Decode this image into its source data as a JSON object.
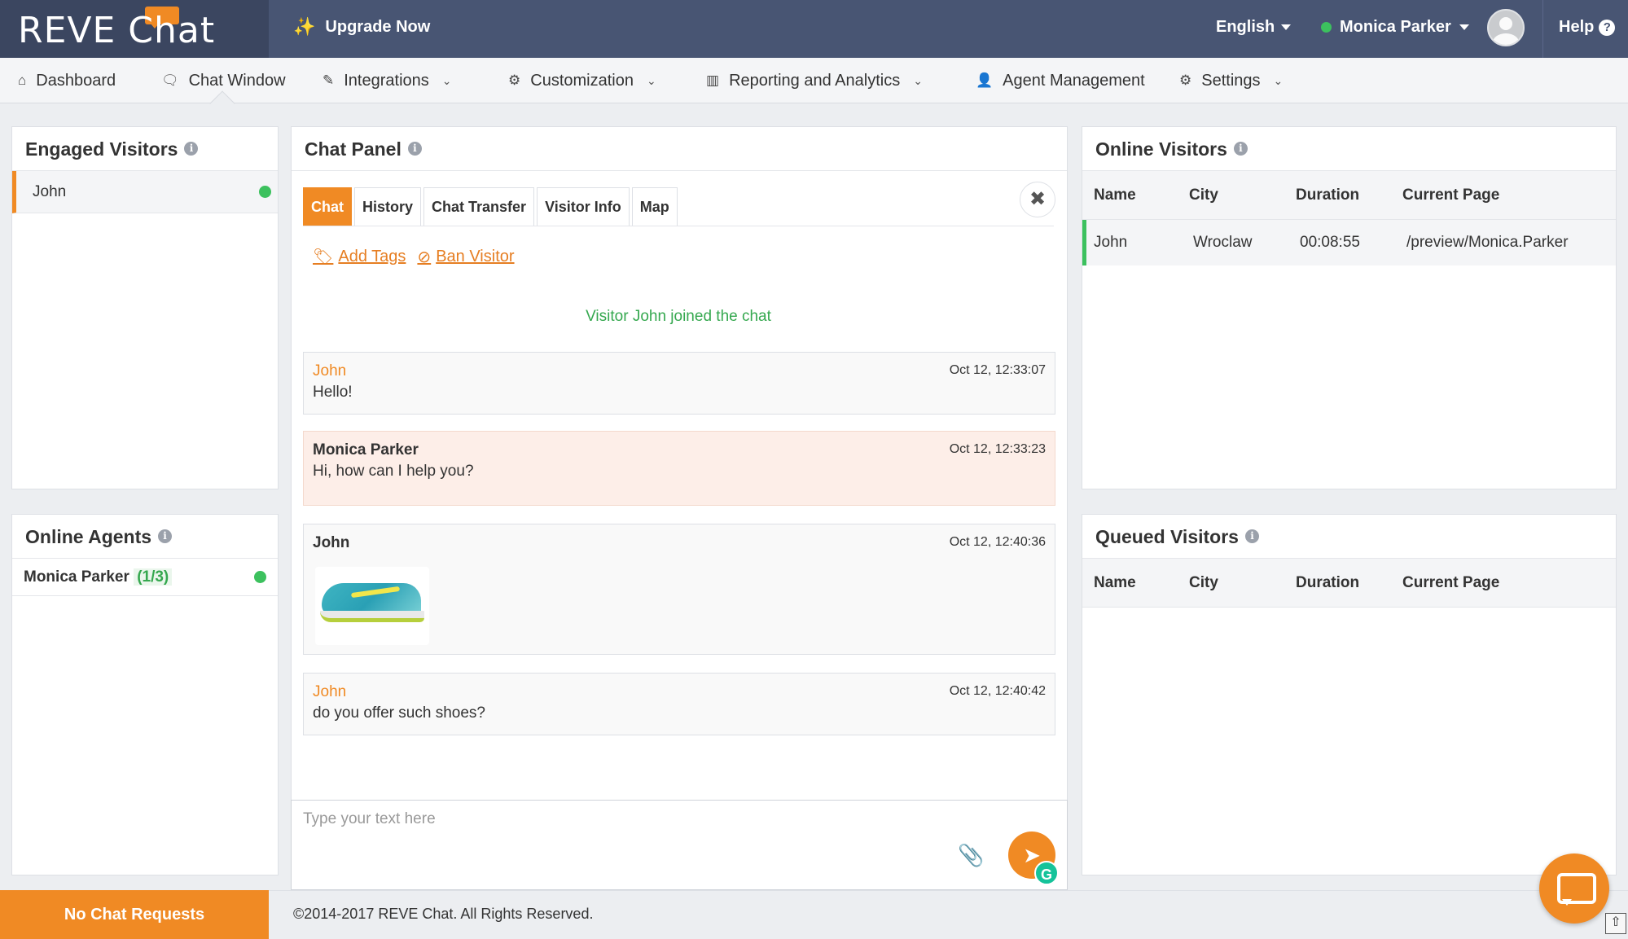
{
  "topbar": {
    "logo": "REVE Chat",
    "upgrade_label": "Upgrade Now",
    "language": "English",
    "agent_name": "Monica Parker",
    "help_label": "Help",
    "accent_color": "#f08a24",
    "bg_color": "#485573"
  },
  "nav": {
    "items": [
      {
        "label": "Dashboard",
        "icon": "home-icon"
      },
      {
        "label": "Chat Window",
        "icon": "chat-icon"
      },
      {
        "label": "Integrations",
        "icon": "plug-icon"
      },
      {
        "label": "Customization",
        "icon": "gear-icon"
      },
      {
        "label": "Reporting and Analytics",
        "icon": "bar-chart-icon"
      },
      {
        "label": "Agent Management",
        "icon": "user-icon"
      },
      {
        "label": "Settings",
        "icon": "gears-icon"
      }
    ],
    "active": "Chat Window"
  },
  "engaged": {
    "title": "Engaged Visitors",
    "visitors": [
      {
        "name": "John",
        "status": "online"
      }
    ]
  },
  "agents": {
    "title": "Online Agents",
    "list": [
      {
        "name": "Monica Parker",
        "load": "(1/3)"
      }
    ]
  },
  "chat": {
    "title": "Chat Panel",
    "tabs": [
      "Chat",
      "History",
      "Chat Transfer",
      "Visitor Info",
      "Map"
    ],
    "active_tab": "Chat",
    "add_tags": "Add Tags",
    "ban_visitor": "Ban Visitor",
    "system_message": "Visitor John joined the chat",
    "messages": [
      {
        "sender": "John",
        "time": "Oct 12, 12:33:07",
        "text": "Hello!"
      },
      {
        "sender": "Monica Parker",
        "time": "Oct 12, 12:33:23",
        "text": "Hi, how can I help you?"
      },
      {
        "sender": "John",
        "time": "Oct 12, 12:40:36",
        "text": ""
      },
      {
        "sender": "John",
        "time": "Oct 12, 12:40:42",
        "text": "do you offer such shoes?"
      }
    ],
    "input_placeholder": "Type your text here"
  },
  "online_visitors": {
    "title": "Online Visitors",
    "columns": [
      "Name",
      "City",
      "Duration",
      "Current Page"
    ],
    "rows": [
      [
        "John",
        "Wroclaw",
        "00:08:55",
        "/preview/Monica.Parker"
      ]
    ]
  },
  "queued_visitors": {
    "title": "Queued Visitors",
    "columns": [
      "Name",
      "City",
      "Duration",
      "Current Page"
    ]
  },
  "footer": {
    "no_chat": "No Chat Requests",
    "copyright": "©2014-2017 REVE Chat. All Rights Reserved."
  }
}
